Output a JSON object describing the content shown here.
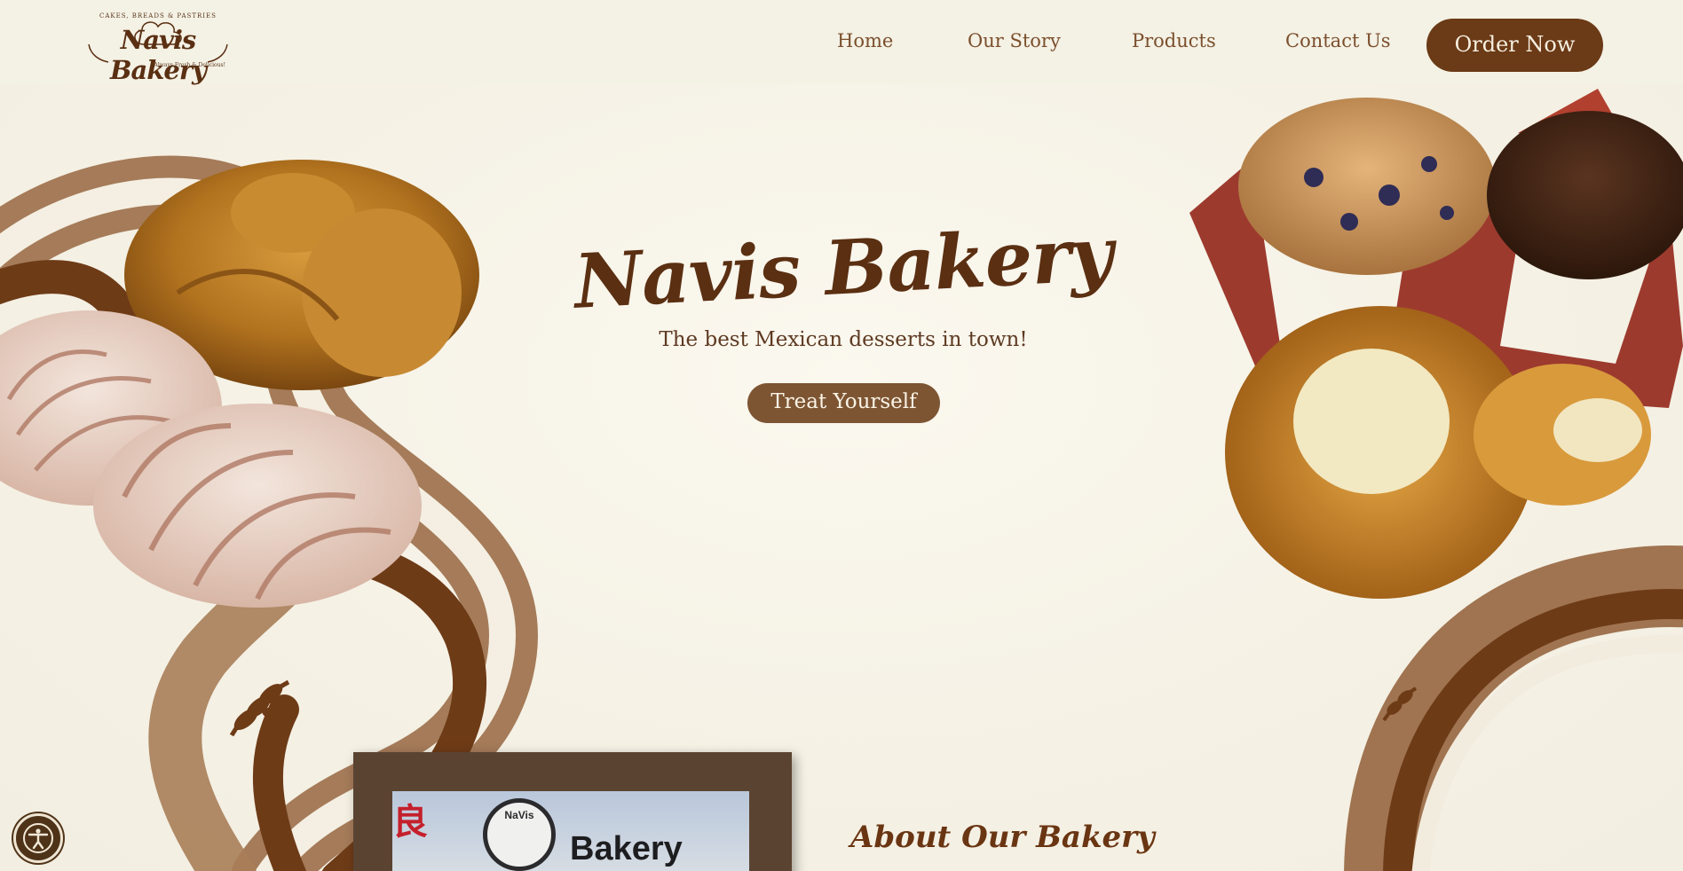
{
  "header": {
    "logo": {
      "tagline_top": "CAKES, BREADS & PASTRIES",
      "name": "Navis Bakery",
      "tagline_bottom": "Always Fresh & Delicious!"
    },
    "nav": [
      {
        "label": "Home"
      },
      {
        "label": "Our Story"
      },
      {
        "label": "Products"
      },
      {
        "label": "Contact Us"
      }
    ],
    "order_button": "Order Now"
  },
  "hero": {
    "title": "Navis Bakery",
    "subtitle": "The best Mexican desserts in town!",
    "cta": "Treat Yourself"
  },
  "about": {
    "heading": "About Our Bakery",
    "photo_sign": {
      "circle_text": "NaVis",
      "sign_text": "Bakery",
      "red_char": "良"
    }
  },
  "accessibility": {
    "icon": "accessibility-icon"
  },
  "colors": {
    "background": "#f6f3e8",
    "brand_brown": "#6b3a16",
    "nav_text": "#7b4f2c",
    "cta_brown": "#7d5533",
    "swirl_light": "#a07451",
    "swirl_dark": "#6e3b17"
  }
}
